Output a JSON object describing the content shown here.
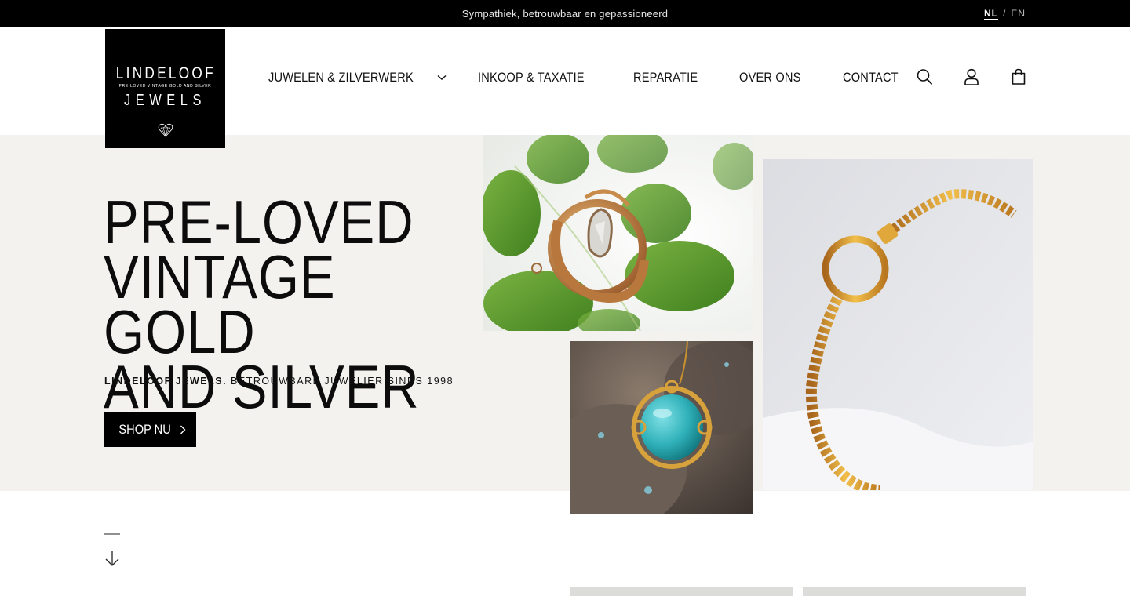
{
  "topbar": {
    "tagline": "Sympathiek, betrouwbaar en gepassioneerd",
    "lang_active": "NL",
    "lang_sep": "/",
    "lang_other": "EN"
  },
  "logo": {
    "line1": "LINDELOOF",
    "line2": "PRE-LOVED VINTAGE GOLD AND SILVER",
    "line3": "JEWELS"
  },
  "nav": {
    "items": [
      {
        "label": "JUWELEN & ZILVERWERK",
        "has_dropdown": true
      },
      {
        "label": "INKOOP & TAXATIE"
      },
      {
        "label": "REPARATIE"
      },
      {
        "label": "OVER ONS"
      },
      {
        "label": "CONTACT"
      }
    ]
  },
  "header_icons": [
    "search-icon",
    "account-icon",
    "cart-bag-icon"
  ],
  "hero": {
    "title_line1": "PRE-LOVED",
    "title_line2": "VINTAGE GOLD",
    "title_line3": "AND SILVER",
    "sub_bold": "LINDELOOF JEWELS.",
    "sub_rest": " BETROUWBARE JUWELIER SINDS 1998",
    "cta": "SHOP NU"
  },
  "colors": {
    "black": "#000000",
    "hero_bg": "#f3f2ef",
    "gold": "#c9922e",
    "turquoise": "#2fb0b8",
    "leaf_green": "#5a9a2a"
  }
}
